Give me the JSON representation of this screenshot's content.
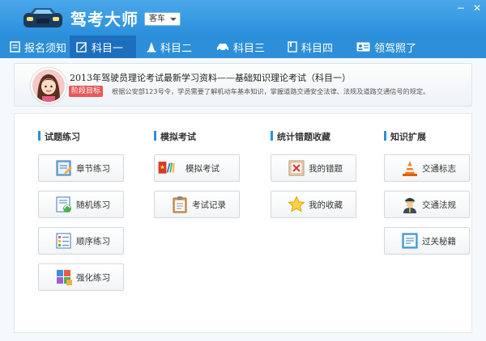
{
  "app": {
    "title": "驾考大师",
    "vehicle_select": "客车"
  },
  "nav": {
    "items": [
      {
        "label": "报名须知"
      },
      {
        "label": "科目一"
      },
      {
        "label": "科目二"
      },
      {
        "label": "科目三"
      },
      {
        "label": "科目四"
      },
      {
        "label": "领驾照了"
      }
    ]
  },
  "banner": {
    "title": "2013年驾驶员理论考试最新学习资料——基础知识理论考试（科目一）",
    "badge": "阶段目标",
    "desc": "根据公安部123号令，学员需要了解机动车基本知识，掌握道路交通安全法律、法规及道路交通信号的规定。"
  },
  "sections": {
    "practice": {
      "title": "试题练习",
      "items": [
        {
          "label": "章节练习",
          "icon": "chapter-notebook-icon"
        },
        {
          "label": "随机练习",
          "icon": "random-shuffle-icon"
        },
        {
          "label": "顺序练习",
          "icon": "sequence-list-icon"
        },
        {
          "label": "强化练习",
          "icon": "reinforce-blocks-icon"
        }
      ]
    },
    "mock": {
      "title": "模拟考试",
      "items": [
        {
          "label": "模拟考试",
          "icon": "flag-pencil-icon"
        },
        {
          "label": "考试记录",
          "icon": "clipboard-icon"
        }
      ]
    },
    "errors": {
      "title": "统计错题收藏",
      "items": [
        {
          "label": "我的错题",
          "icon": "wrong-x-icon"
        },
        {
          "label": "我的收藏",
          "icon": "star-icon"
        }
      ]
    },
    "knowledge": {
      "title": "知识扩展",
      "items": [
        {
          "label": "交通标志",
          "icon": "traffic-cone-icon"
        },
        {
          "label": "交通法规",
          "icon": "police-officer-icon"
        },
        {
          "label": "过关秘籍",
          "icon": "certificate-icon"
        }
      ]
    }
  },
  "colors": {
    "titlebar": "#3b9de4",
    "navbar": "#2d8fd9",
    "nav_active": "#1d6fbd",
    "badge": "#e6595a"
  }
}
